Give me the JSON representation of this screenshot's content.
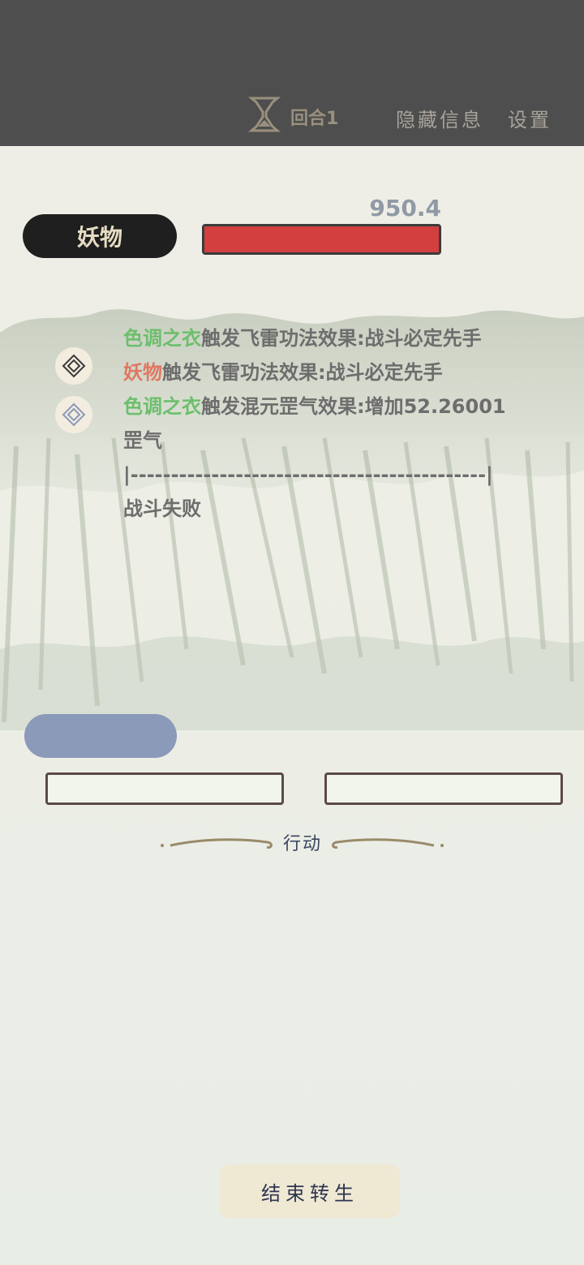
{
  "header": {
    "round_label": "回合1",
    "hide_info_label": "隐藏信息",
    "settings_label": "设置"
  },
  "enemy": {
    "name": "妖物",
    "hp_value": "950.4",
    "hp_fraction": 1.0
  },
  "battle_log": {
    "lines": [
      {
        "segments": [
          {
            "text": "色调之衣",
            "color": "green"
          },
          {
            "text": "触发飞雷功法效果:战斗必定先手",
            "color": "default"
          }
        ]
      },
      {
        "segments": [
          {
            "text": "妖物",
            "color": "red"
          },
          {
            "text": "触发飞雷功法效果:战斗必定先手",
            "color": "default"
          }
        ]
      },
      {
        "segments": [
          {
            "text": "色调之衣",
            "color": "green"
          },
          {
            "text": "触发混元罡气效果:增加52.26001",
            "color": "default"
          }
        ]
      },
      {
        "segments": [
          {
            "text": "罡气",
            "color": "default"
          }
        ]
      },
      {
        "segments": [
          {
            "text": "|--------------------------------------------|",
            "color": "default"
          }
        ]
      },
      {
        "segments": [
          {
            "text": "战斗失败",
            "color": "default"
          }
        ]
      }
    ]
  },
  "action_section": {
    "label": "行动"
  },
  "footer": {
    "end_button_label": "结束转生"
  },
  "colors": {
    "top_bar": "#4e4e4e",
    "hp_bar": "#d33f3f",
    "green_text": "#6cbf6c",
    "red_text": "#e07861",
    "blue_pill": "#8a9ab8"
  },
  "icons": [
    "hourglass-icon",
    "diamond-icon"
  ]
}
